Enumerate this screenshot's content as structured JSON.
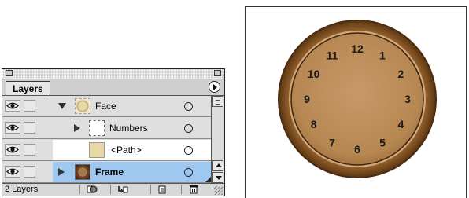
{
  "palette": {
    "tab_label": "Layers",
    "layer_count": "2 Layers",
    "layers": [
      {
        "name": "Face",
        "expanded": true,
        "selected": false,
        "bold": false
      },
      {
        "name": "Numbers",
        "expanded": false,
        "selected": false,
        "bold": false
      },
      {
        "name": "<Path>",
        "expanded": false,
        "selected": false,
        "bold": false
      },
      {
        "name": "Frame",
        "expanded": false,
        "selected": true,
        "bold": true
      }
    ]
  },
  "clock": {
    "numerals": [
      "12",
      "1",
      "2",
      "3",
      "4",
      "5",
      "6",
      "7",
      "8",
      "9",
      "10",
      "11"
    ],
    "colors": {
      "rim": "#8a5a28",
      "rim_dark": "#5a3510",
      "face": "#b98b58",
      "face_edge": "#d2a877"
    }
  },
  "colors": {
    "selection": "#9fc8f0",
    "palette_bg": "#dedede"
  }
}
